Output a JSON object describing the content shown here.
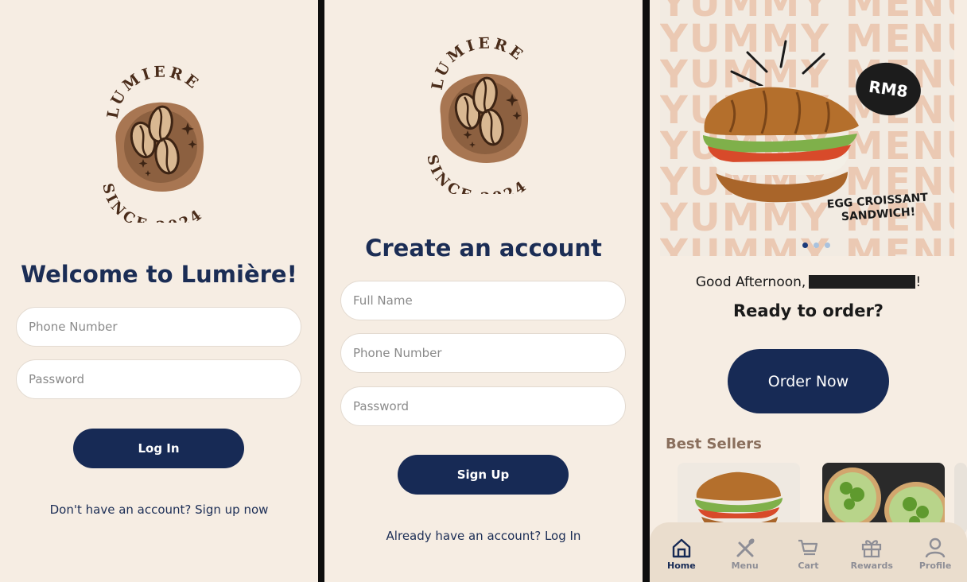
{
  "login": {
    "logo": {
      "brand": "LUMIERE",
      "since": "SINCE 2024"
    },
    "title": "Welcome to Lumière!",
    "phone_placeholder": "Phone Number",
    "password_placeholder": "Password",
    "login_label": "Log In",
    "footer_text": "Don't have an account? ",
    "footer_link": "Sign up now"
  },
  "signup": {
    "logo": {
      "brand": "LUMIERE",
      "since": "SINCE 2024"
    },
    "title": "Create an account",
    "fullname_placeholder": "Full Name",
    "phone_placeholder": "Phone Number",
    "password_placeholder": "Password",
    "signup_label": "Sign Up",
    "footer_text": "Already have an account? ",
    "footer_link": "Log In"
  },
  "home": {
    "banner": {
      "bg_text": "YUMMY MENU",
      "price": "RM8",
      "caption_line1": "EGG CROISSANT",
      "caption_line2": "SANDWICH!",
      "dots": 3,
      "active_dot": 0
    },
    "greeting": "Good Afternoon,",
    "greeting_end": "!",
    "ready": "Ready to order?",
    "order_label": "Order Now",
    "best_sellers_title": "Best Sellers",
    "tabs": [
      {
        "label": "Home",
        "icon": "home-icon",
        "active": true
      },
      {
        "label": "Menu",
        "icon": "utensils-icon",
        "active": false
      },
      {
        "label": "Cart",
        "icon": "cart-icon",
        "active": false
      },
      {
        "label": "Rewards",
        "icon": "gift-icon",
        "active": false
      },
      {
        "label": "Profile",
        "icon": "profile-icon",
        "active": false
      }
    ]
  },
  "colors": {
    "background": "#f6ede3",
    "primary": "#172a55",
    "logo_brown": "#a87652",
    "logo_text": "#4a2c1a"
  }
}
